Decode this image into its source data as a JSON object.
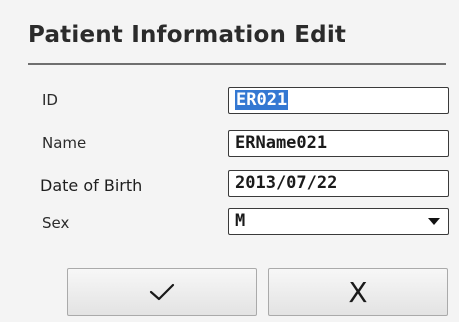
{
  "dialog": {
    "title": "Patient Information Edit"
  },
  "fields": {
    "id": {
      "label": "ID",
      "value": "ER021"
    },
    "name": {
      "label": "Name",
      "value": "ERName021"
    },
    "dob": {
      "label": "Date of Birth",
      "value": "2013/07/22"
    },
    "sex": {
      "label": "Sex",
      "value": "M"
    }
  },
  "buttons": {
    "confirm_icon": "check-icon",
    "cancel_label": "X"
  }
}
